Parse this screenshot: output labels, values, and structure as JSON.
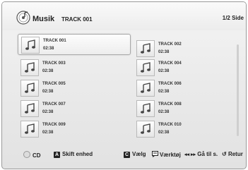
{
  "header": {
    "title": "Musik",
    "subtitle": "TRACK 001",
    "page_indicator": "1/2 Side"
  },
  "tracks": [
    {
      "name": "TRACK 001",
      "duration": "02:38",
      "selected": true
    },
    {
      "name": "TRACK 002",
      "duration": "02:38",
      "selected": false
    },
    {
      "name": "TRACK 003",
      "duration": "02:38",
      "selected": false
    },
    {
      "name": "TRACK 004",
      "duration": "02:38",
      "selected": false
    },
    {
      "name": "TRACK 005",
      "duration": "02:38",
      "selected": false
    },
    {
      "name": "TRACK 006",
      "duration": "02:38",
      "selected": false
    },
    {
      "name": "TRACK 007",
      "duration": "02:38",
      "selected": false
    },
    {
      "name": "TRACK 008",
      "duration": "02:38",
      "selected": false
    },
    {
      "name": "TRACK 009",
      "duration": "02:38",
      "selected": false
    },
    {
      "name": "TRACK 010",
      "duration": "02:38",
      "selected": false
    }
  ],
  "footer": {
    "cd_label": "CD",
    "a_key": "A",
    "a_label": "Skift enhed",
    "c_key": "C",
    "c_label": "Vælg",
    "tools_label": "Værktøj",
    "pages_label": "Gå til s.",
    "return_label": "Retur"
  },
  "icons": {
    "header": "music-disc-icon",
    "track": "music-note-icon",
    "tools": "tools-icon",
    "pages": "skip-arrows-icon",
    "return": "return-icon",
    "cd": "navigation-disc-icon"
  }
}
